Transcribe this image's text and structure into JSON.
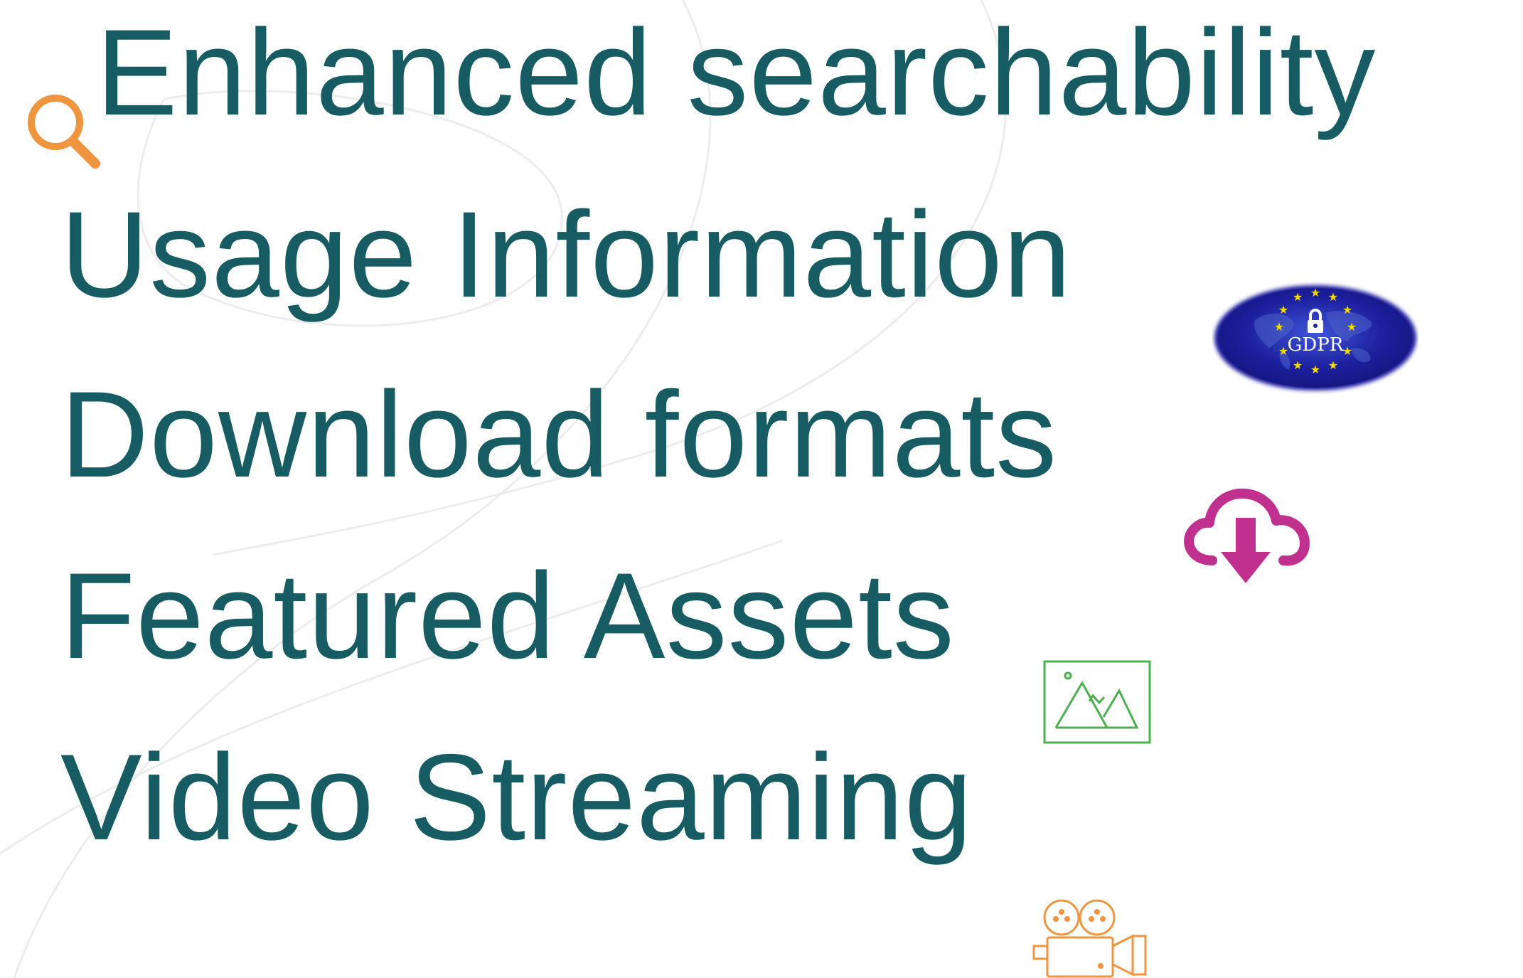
{
  "features": [
    {
      "label": "Enhanced searchability",
      "icon": "search-icon"
    },
    {
      "label": "Usage Information",
      "icon": "gdpr-badge"
    },
    {
      "label": "Download formats",
      "icon": "cloud-download-icon"
    },
    {
      "label": "Featured Assets",
      "icon": "image-icon"
    },
    {
      "label": "Video Streaming",
      "icon": "video-camera-icon"
    }
  ],
  "gdpr_badge": {
    "text": "GDPR"
  },
  "colors": {
    "text": "#175c62",
    "search_icon": "#f0953f",
    "gdpr_blue": "#1c1f9e",
    "gdpr_star": "#f5d90a",
    "download_icon": "#c0308f",
    "image_icon": "#4caf50",
    "camera_icon": "#f0953f"
  }
}
